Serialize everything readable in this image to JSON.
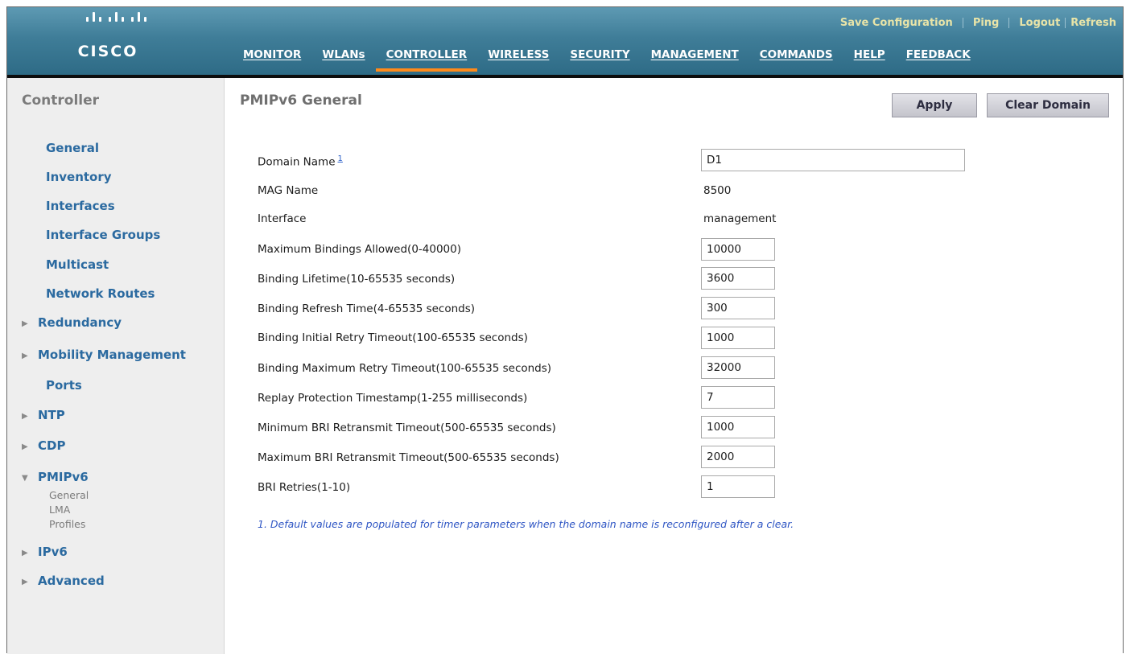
{
  "header": {
    "brand": "CISCO",
    "top_links": [
      "Save Configuration",
      "Ping",
      "Logout",
      "Refresh"
    ],
    "nav": [
      "MONITOR",
      "WLANs",
      "CONTROLLER",
      "WIRELESS",
      "SECURITY",
      "MANAGEMENT",
      "COMMANDS",
      "HELP",
      "FEEDBACK"
    ],
    "active_nav": "CONTROLLER",
    "accent_color": "#ff8a1a"
  },
  "sidebar": {
    "title": "Controller",
    "items": [
      "General",
      "Inventory",
      "Interfaces",
      "Interface Groups",
      "Multicast",
      "Network Routes",
      "Redundancy",
      "Mobility Management",
      "Ports",
      "NTP",
      "CDP",
      "PMIPv6",
      "IPv6",
      "Advanced"
    ],
    "pmipv6_sub": [
      "General",
      "LMA",
      "Profiles"
    ]
  },
  "main": {
    "title": "PMIPv6 General",
    "buttons": {
      "apply": "Apply",
      "clear_domain": "Clear Domain"
    },
    "fields": [
      {
        "label": "Domain Name",
        "footnote": "1",
        "value": "D1"
      },
      {
        "label": "MAG Name",
        "value": "8500"
      },
      {
        "label": "Interface",
        "value": "management"
      },
      {
        "label": "Maximum Bindings Allowed(0-40000)",
        "value": "10000"
      },
      {
        "label": "Binding Lifetime(10-65535 seconds)",
        "value": "3600"
      },
      {
        "label": "Binding Refresh Time(4-65535 seconds)",
        "value": "300"
      },
      {
        "label": "Binding Initial Retry Timeout(100-65535 seconds)",
        "value": "1000"
      },
      {
        "label": "Binding Maximum Retry Timeout(100-65535 seconds)",
        "value": "32000"
      },
      {
        "label": "Replay Protection Timestamp(1-255 milliseconds)",
        "value": "7"
      },
      {
        "label": "Minimum BRI Retransmit Timeout(500-65535 seconds)",
        "value": "1000"
      },
      {
        "label": "Maximum BRI Retransmit Timeout(500-65535 seconds)",
        "value": "2000"
      },
      {
        "label": "BRI Retries(1-10)",
        "value": "1"
      }
    ],
    "note": "1. Default values are populated for timer parameters when the domain name is reconfigured after a clear."
  }
}
